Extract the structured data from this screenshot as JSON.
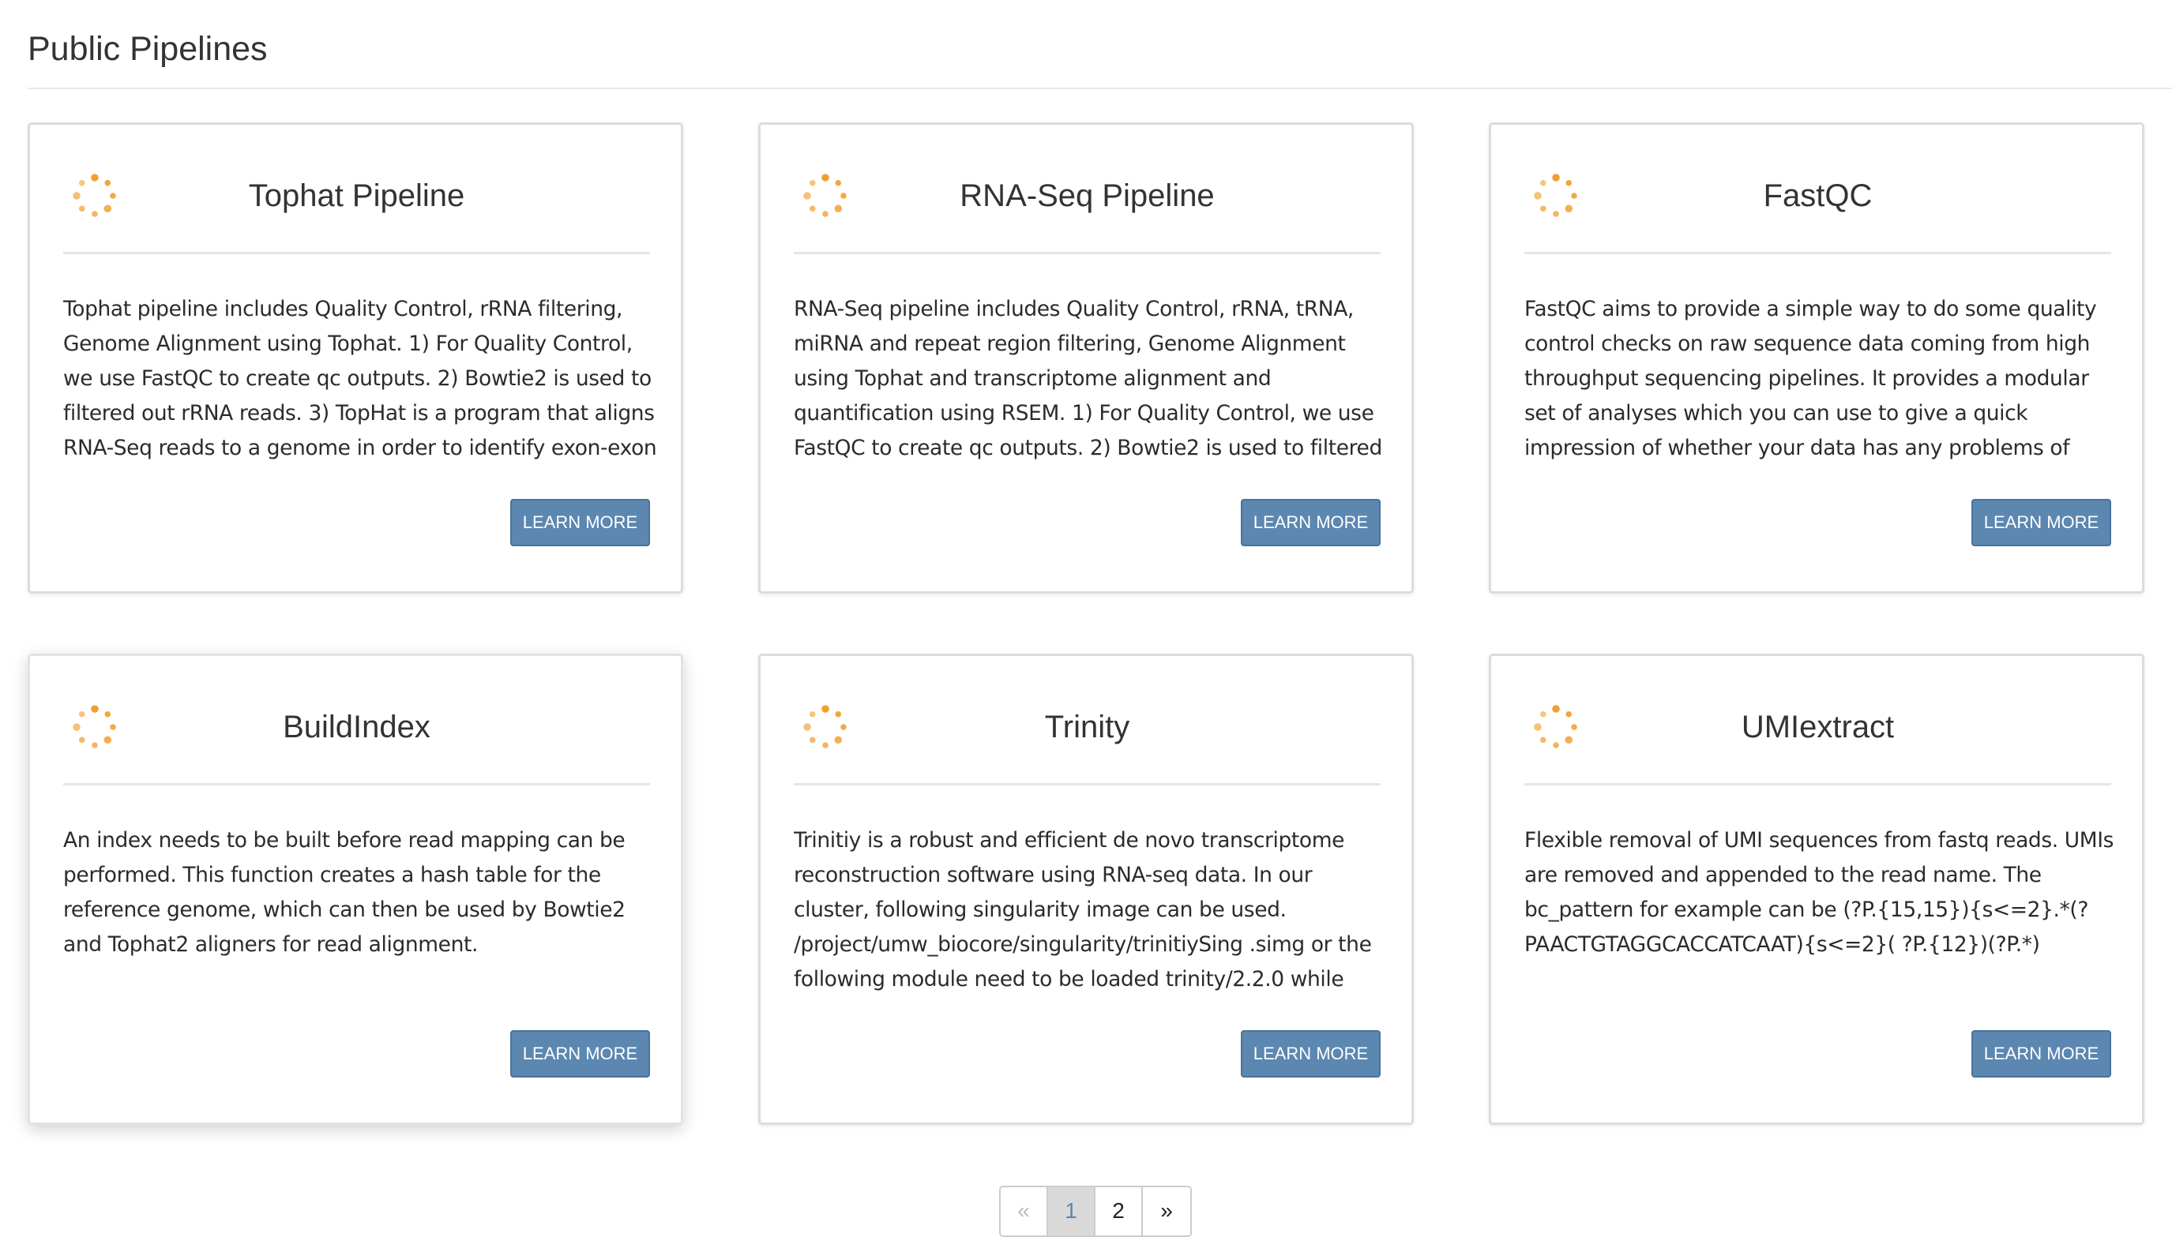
{
  "page": {
    "title": "Public Pipelines"
  },
  "accent_color": "#f0a030",
  "button_color": "#5b87b1",
  "spinner_icon": "loading-spinner-icon",
  "cards": [
    {
      "title": "Tophat Pipeline",
      "description": "Tophat pipeline includes Quality Control, rRNA filtering, Genome Alignment using Tophat. 1) For Quality Control, we use FastQC to create qc outputs. 2) Bowtie2 is used to filtered out rRNA reads. 3) TopHat is a program that aligns RNA-Seq reads to a genome in order to identify exon-exon",
      "button": "LEARN MORE"
    },
    {
      "title": "RNA-Seq Pipeline",
      "description": "RNA-Seq pipeline includes Quality Control, rRNA, tRNA, miRNA and repeat region filtering, Genome Alignment using Tophat and transcriptome alignment and quantification using RSEM. 1) For Quality Control, we use FastQC to create qc outputs. 2) Bowtie2 is used to filtered",
      "button": "LEARN MORE"
    },
    {
      "title": "FastQC",
      "description": "FastQC aims to provide a simple way to do some quality control checks on raw sequence data coming from high throughput sequencing pipelines. It provides a modular set of analyses which you can use to give a quick impression of whether your data has any problems of which you should",
      "button": "LEARN MORE"
    },
    {
      "title": "BuildIndex",
      "description": "An index needs to be built before read mapping can be performed. This function creates a hash table for the reference genome, which can then be used by Bowtie2 and Tophat2 aligners for read alignment.",
      "button": "LEARN MORE"
    },
    {
      "title": "Trinity",
      "description": "Trinitiy is a robust and efficient de novo transcriptome reconstruction software using RNA-seq data. In our cluster, following singularity image can be used. /project/umw_biocore/singularity/trinitiySing .simg or the following module need to be loaded trinity/2.2.0 while",
      "button": "LEARN MORE"
    },
    {
      "title": "UMIextract",
      "description": "Flexible removal of UMI sequences from fastq reads. UMIs are removed and appended to the read name. The bc_pattern for example can be (?P.{15,15}){s<=2}.*(?PAACTGTAGGCACCATCAAT){s<=2}( ?P.{12})(?P.*)",
      "button": "LEARN MORE"
    }
  ],
  "pagination": {
    "prev": "«",
    "pages": [
      "1",
      "2"
    ],
    "current": "1",
    "next": "»"
  }
}
